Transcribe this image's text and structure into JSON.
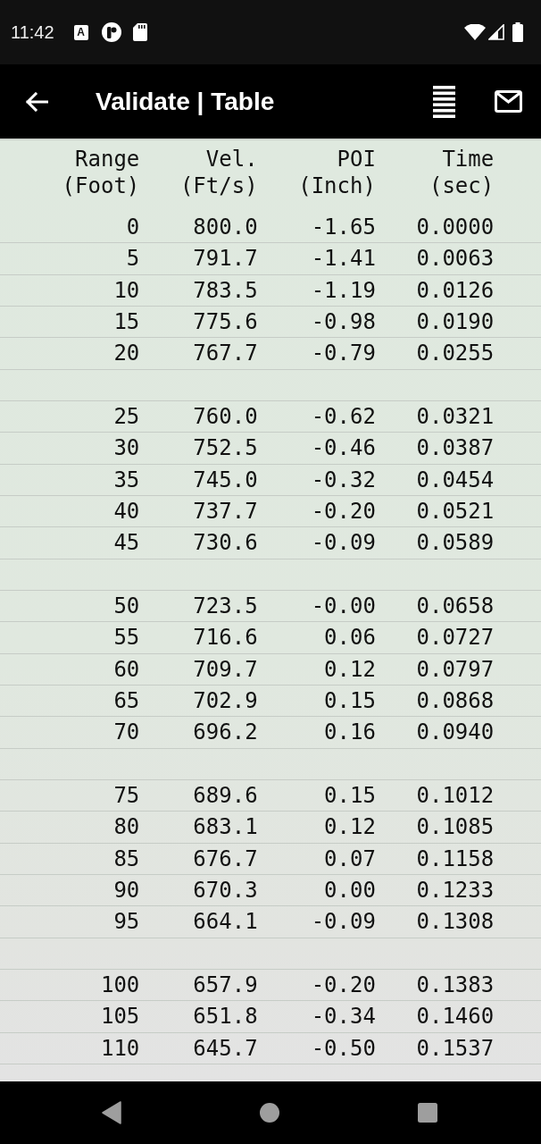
{
  "status_bar": {
    "time": "11:42",
    "notification_badge": "A"
  },
  "app_bar": {
    "title": "Validate | Table"
  },
  "table": {
    "columns": [
      {
        "name": "Range",
        "unit": "(Foot)"
      },
      {
        "name": "Vel.",
        "unit": "(Ft/s)"
      },
      {
        "name": "POI",
        "unit": "(Inch)"
      },
      {
        "name": "Time",
        "unit": "(sec)"
      }
    ],
    "groups": [
      {
        "rows": [
          [
            "0",
            "800.0",
            "-1.65",
            "0.0000"
          ],
          [
            "5",
            "791.7",
            "-1.41",
            "0.0063"
          ],
          [
            "10",
            "783.5",
            "-1.19",
            "0.0126"
          ],
          [
            "15",
            "775.6",
            "-0.98",
            "0.0190"
          ],
          [
            "20",
            "767.7",
            "-0.79",
            "0.0255"
          ]
        ]
      },
      {
        "rows": [
          [
            "25",
            "760.0",
            "-0.62",
            "0.0321"
          ],
          [
            "30",
            "752.5",
            "-0.46",
            "0.0387"
          ],
          [
            "35",
            "745.0",
            "-0.32",
            "0.0454"
          ],
          [
            "40",
            "737.7",
            "-0.20",
            "0.0521"
          ],
          [
            "45",
            "730.6",
            "-0.09",
            "0.0589"
          ]
        ]
      },
      {
        "rows": [
          [
            "50",
            "723.5",
            "-0.00",
            "0.0658"
          ],
          [
            "55",
            "716.6",
            "0.06",
            "0.0727"
          ],
          [
            "60",
            "709.7",
            "0.12",
            "0.0797"
          ],
          [
            "65",
            "702.9",
            "0.15",
            "0.0868"
          ],
          [
            "70",
            "696.2",
            "0.16",
            "0.0940"
          ]
        ]
      },
      {
        "rows": [
          [
            "75",
            "689.6",
            "0.15",
            "0.1012"
          ],
          [
            "80",
            "683.1",
            "0.12",
            "0.1085"
          ],
          [
            "85",
            "676.7",
            "0.07",
            "0.1158"
          ],
          [
            "90",
            "670.3",
            "0.00",
            "0.1233"
          ],
          [
            "95",
            "664.1",
            "-0.09",
            "0.1308"
          ]
        ]
      },
      {
        "rows": [
          [
            "100",
            "657.9",
            "-0.20",
            "0.1383"
          ],
          [
            "105",
            "651.8",
            "-0.34",
            "0.1460"
          ],
          [
            "110",
            "645.7",
            "-0.50",
            "0.1537"
          ]
        ]
      }
    ]
  }
}
